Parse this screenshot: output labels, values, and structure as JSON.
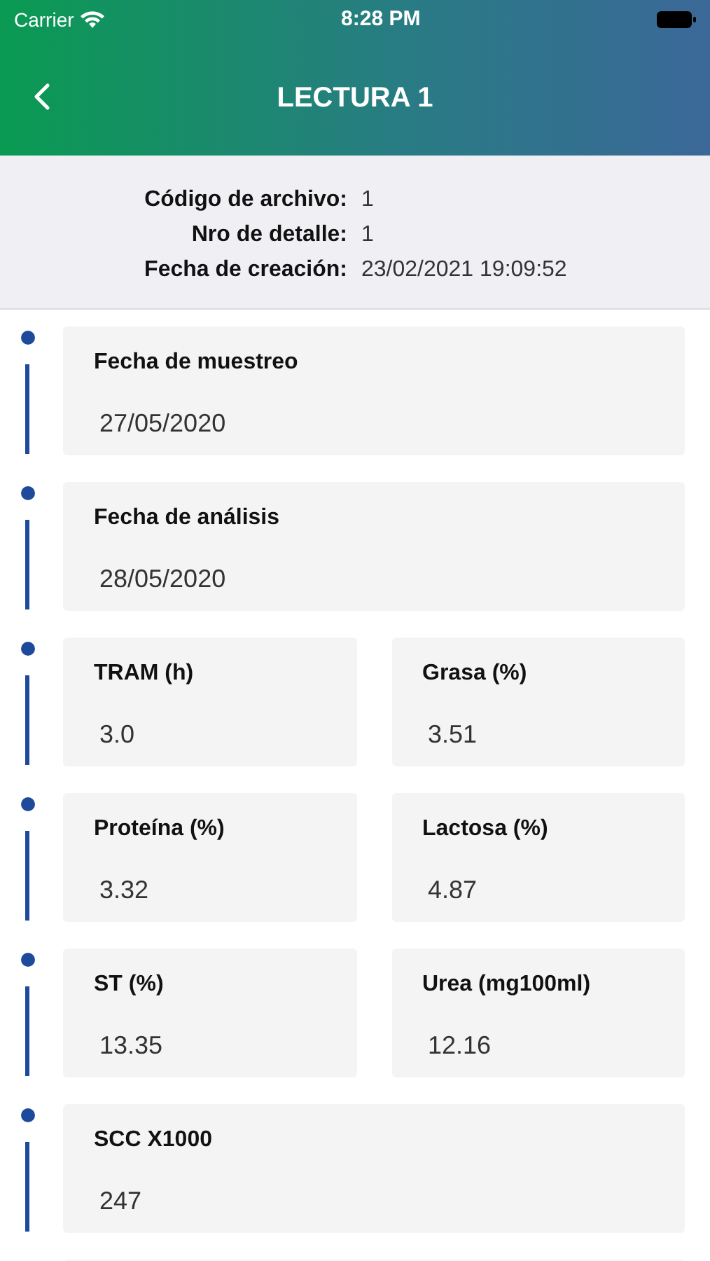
{
  "status_bar": {
    "carrier": "Carrier",
    "time": "8:28 PM"
  },
  "header": {
    "title": "LECTURA 1"
  },
  "info": [
    {
      "label": "Código de archivo:",
      "value": "1"
    },
    {
      "label": "Nro de detalle:",
      "value": "1"
    },
    {
      "label": "Fecha de creación:",
      "value": "23/02/2021 19:09:52"
    }
  ],
  "sections": [
    {
      "cards": [
        {
          "label": "Fecha de muestreo",
          "value": "27/05/2020"
        }
      ]
    },
    {
      "cards": [
        {
          "label": "Fecha de análisis",
          "value": "28/05/2020"
        }
      ]
    },
    {
      "cards": [
        {
          "label": "TRAM (h)",
          "value": "3.0"
        },
        {
          "label": "Grasa (%)",
          "value": "3.51"
        }
      ]
    },
    {
      "cards": [
        {
          "label": "Proteína (%)",
          "value": "3.32"
        },
        {
          "label": "Lactosa (%)",
          "value": "4.87"
        }
      ]
    },
    {
      "cards": [
        {
          "label": "ST (%)",
          "value": "13.35"
        },
        {
          "label": "Urea (mg100ml)",
          "value": "12.16"
        }
      ]
    },
    {
      "cards": [
        {
          "label": "SCC X1000",
          "value": "247"
        }
      ]
    }
  ]
}
